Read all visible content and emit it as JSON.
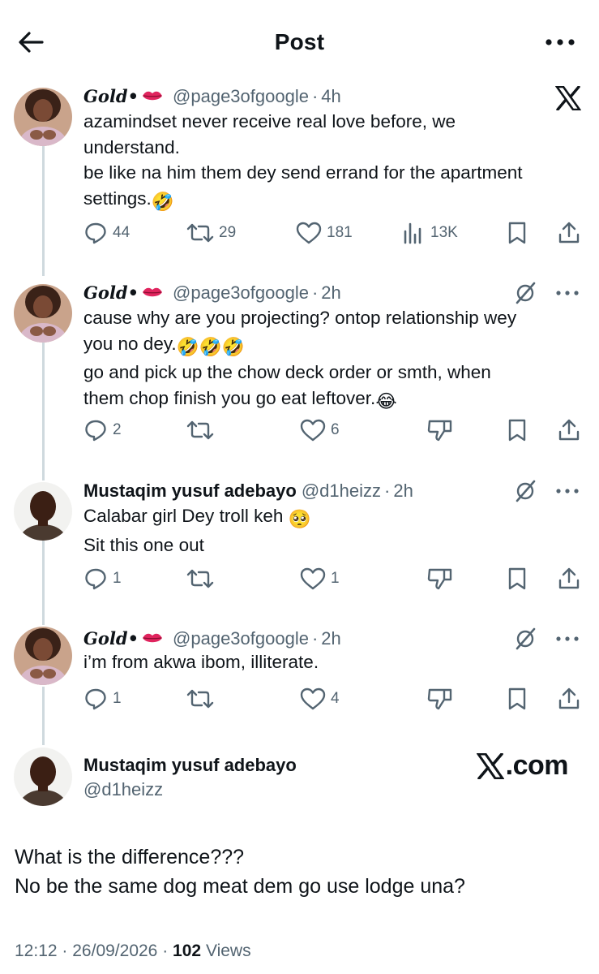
{
  "header": {
    "title": "Post",
    "back_icon": "arrow-left-icon",
    "more_icon": "more-horizontal-icon"
  },
  "replies": [
    {
      "display_name": "Gold•",
      "display_name_emoji": "lips",
      "handle": "@page3ofgoogle",
      "time": "4h",
      "top_right_icon": "x-logo-icon",
      "lines": [
        "azamindset never receive real love before, we",
        "understand.",
        "be like na him them dey send errand for the apartment",
        "settings."
      ],
      "line_end_emojis": [
        "",
        "",
        "",
        "🤣"
      ],
      "actions": {
        "reply_count": "44",
        "repost_count": "29",
        "like_count": "181",
        "views_count": "13K"
      }
    },
    {
      "display_name": "Gold•",
      "display_name_emoji": "lips",
      "handle": "@page3ofgoogle",
      "time": "2h",
      "lines": [
        "cause why are you projecting? ontop relationship wey",
        "you no dey.",
        "go and pick up the chow deck order or smth, when",
        "them chop finish you go eat leftover."
      ],
      "line_end_emojis": [
        "",
        "🤣🤣🤣",
        "",
        "😂"
      ],
      "actions": {
        "reply_count": "2",
        "repost_count": "",
        "like_count": "6"
      }
    },
    {
      "display_name": "Mustaqim yusuf adebayo",
      "handle": "@d1heizz",
      "time": "2h",
      "lines": [
        "Calabar girl Dey troll keh",
        "Sit this one out"
      ],
      "line_end_emojis": [
        "🥺",
        ""
      ],
      "actions": {
        "reply_count": "1",
        "repost_count": "",
        "like_count": "1"
      }
    },
    {
      "display_name": "Gold•",
      "display_name_emoji": "lips",
      "handle": "@page3ofgoogle",
      "time": "2h",
      "lines": [
        "i’m from akwa ibom, illiterate."
      ],
      "line_end_emojis": [
        ""
      ],
      "actions": {
        "reply_count": "1",
        "repost_count": "",
        "like_count": "4"
      }
    }
  ],
  "separator": "·",
  "main_post": {
    "display_name": "Mustaqim yusuf adebayo",
    "handle": "@d1heizz",
    "watermark": ".com",
    "lines": [
      "What is the difference???",
      "No be the same dog meat dem go use lodge una?"
    ],
    "time": "12:12",
    "date": "26/09/2026",
    "views_count": "102",
    "views_label": "Views"
  },
  "colors": {
    "text": "#0f1419",
    "secondary": "#536471",
    "thread_line": "#cfd9de",
    "lips": "#e0245e"
  }
}
